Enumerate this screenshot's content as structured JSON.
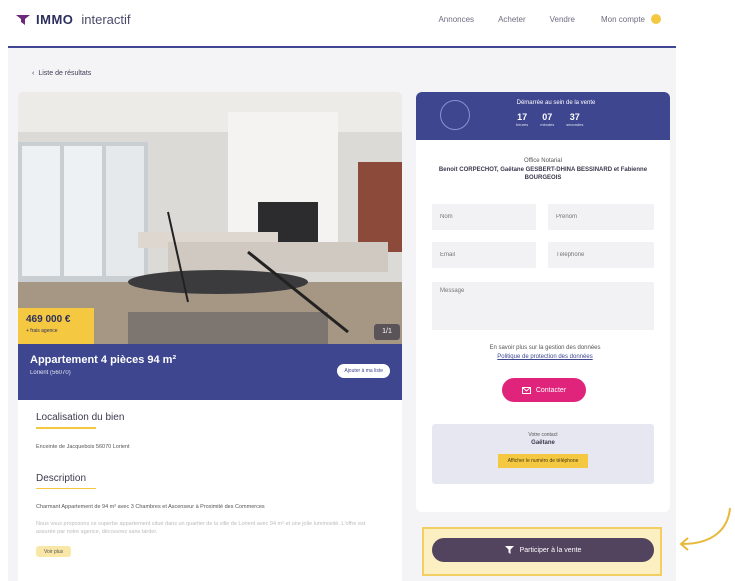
{
  "header": {
    "brand": "IMMO",
    "brand_sub": "interactif",
    "nav": [
      "Annonces",
      "Acheter",
      "Vendre"
    ],
    "account": "Mon compte"
  },
  "back_link": "Liste de résultats",
  "listing": {
    "price": "469 000 €",
    "price_note": "+ frais agence",
    "photo_counter": "1/1",
    "title": "Appartement 4 pièces 94 m²",
    "location": "Lorient (56070)",
    "save_label": "Ajouter à ma liste",
    "location_section": "Localisation du bien",
    "location_text": "Enceinte de Jacquebois 56070 Lorient",
    "description_section": "Description",
    "description_text": "Charmant Appartement de 94 m² avec 3 Chambres et Ascenseur à Proximité des Commerces",
    "description_text_faded": "Nous vous proposons ce superbe appartement situé dans un quartier de la ville de Lorient avec 94 m² et une jolie luminosité. L'offre est assurée par notre agence, découvrez sans tarder.",
    "more_label": "Voir plus"
  },
  "contact": {
    "timer_label": "Démarrée au sein de la vente",
    "timer": [
      {
        "value": "17",
        "unit": "heures"
      },
      {
        "value": "07",
        "unit": "minutes"
      },
      {
        "value": "37",
        "unit": "secondes"
      }
    ],
    "office_label": "Office Notarial",
    "office_names": "Benoit CORPECHOT, Gaëtane GESBERT-DHINA BESSINARD et Fabienne BOURGEOIS",
    "fields": {
      "lastname": "Nom",
      "firstname": "Prénom",
      "email": "Email",
      "phone": "Téléphone",
      "message": "Message"
    },
    "consent_text": "En savoir plus sur la gestion des données",
    "consent_link": "Politique de protection des données",
    "contact_button": "Contacter",
    "phone_box_label": "Votre contact",
    "phone_box_name": "Gaëtane",
    "phone_box_button": "Afficher le numéro de téléphone"
  },
  "cta": {
    "label": "Participer à la vente"
  },
  "colors": {
    "primary": "#3e4690",
    "accent_yellow": "#f5c842",
    "accent_pink": "#e0237b",
    "cta_dark": "#52435e"
  }
}
